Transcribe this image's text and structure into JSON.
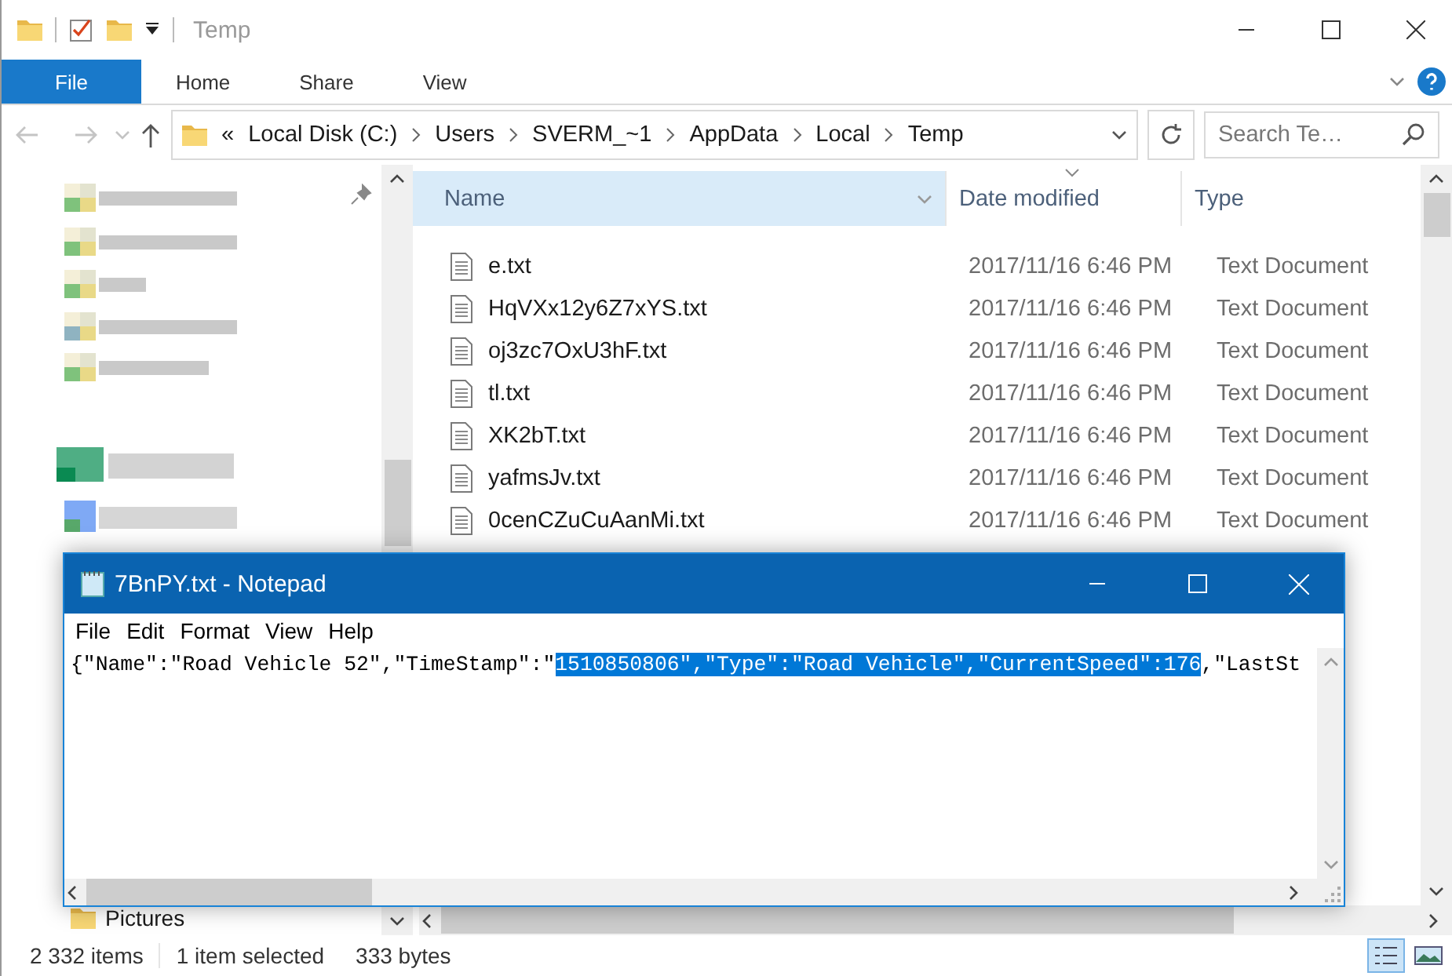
{
  "explorer": {
    "title": "Temp",
    "ribbon_tabs": [
      {
        "label": "File",
        "kind": "file"
      },
      {
        "label": "Home",
        "kind": "tab"
      },
      {
        "label": "Share",
        "kind": "tab"
      },
      {
        "label": "View",
        "kind": "tab"
      }
    ],
    "address": {
      "overflow": "«",
      "crumbs": [
        "Local Disk (C:)",
        "Users",
        "SVERM_~1",
        "AppData",
        "Local",
        "Temp"
      ]
    },
    "search": {
      "placeholder": "Search Te…"
    },
    "nav_pane": {
      "items": [
        {
          "label": "Pictures"
        }
      ]
    },
    "columns": [
      {
        "label": "Name",
        "selected": true,
        "sorted": false
      },
      {
        "label": "Date modified",
        "selected": false,
        "sorted": true
      },
      {
        "label": "Type",
        "selected": false,
        "sorted": false
      }
    ],
    "rows": [
      {
        "name": "e.txt",
        "date": "2017/11/16 6:46 PM",
        "type": "Text Document"
      },
      {
        "name": "HqVXx12y6Z7xYS.txt",
        "date": "2017/11/16 6:46 PM",
        "type": "Text Document"
      },
      {
        "name": "oj3zc7OxU3hF.txt",
        "date": "2017/11/16 6:46 PM",
        "type": "Text Document"
      },
      {
        "name": "tl.txt",
        "date": "2017/11/16 6:46 PM",
        "type": "Text Document"
      },
      {
        "name": "XK2bT.txt",
        "date": "2017/11/16 6:46 PM",
        "type": "Text Document"
      },
      {
        "name": "yafmsJv.txt",
        "date": "2017/11/16 6:46 PM",
        "type": "Text Document"
      },
      {
        "name": "0cenCZuCuAanMi.txt",
        "date": "2017/11/16 6:46 PM",
        "type": "Text Document"
      }
    ],
    "status_bar": {
      "items": [
        "2 332 items",
        "1 item selected",
        "333 bytes"
      ],
      "views": [
        {
          "kind": "details",
          "selected": true
        },
        {
          "kind": "large-icons",
          "selected": false
        }
      ]
    }
  },
  "notepad": {
    "title": "7BnPY.txt - Notepad",
    "menu": [
      "File",
      "Edit",
      "Format",
      "View",
      "Help"
    ],
    "content": [
      {
        "text": "{\"Name\":\"Road Vehicle 52\",\"TimeStamp\":\"",
        "selected": false
      },
      {
        "text": "1510850806\",\"Type\":\"Road Vehicle\",\"CurrentSpeed\":176",
        "selected": true
      },
      {
        "text": ",\"LastSt",
        "selected": false
      }
    ]
  }
}
